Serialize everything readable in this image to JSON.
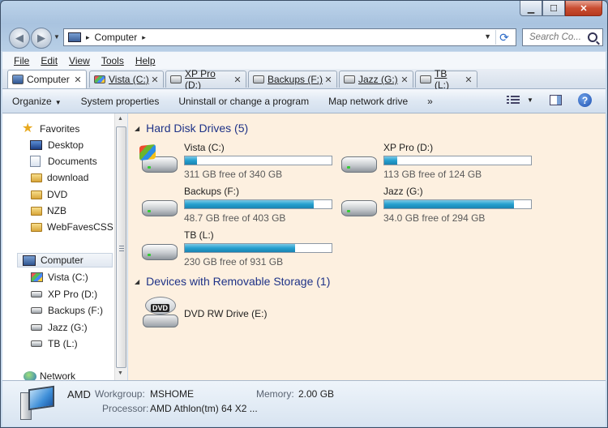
{
  "window": {
    "controls": {
      "minimize": "▁",
      "maximize": "☐",
      "close": "✕"
    }
  },
  "nav": {
    "back": "◀",
    "forward": "▶"
  },
  "address": {
    "location": "Computer",
    "separator": "▸"
  },
  "search": {
    "placeholder": "Search Co..."
  },
  "menu": [
    "File",
    "Edit",
    "View",
    "Tools",
    "Help"
  ],
  "tabs": [
    {
      "label": "Computer",
      "icon": "computer-icon",
      "active": true
    },
    {
      "label": "Vista (C:)",
      "icon": "windows-drive-icon"
    },
    {
      "label": "XP Pro (D:)",
      "icon": "drive-icon"
    },
    {
      "label": "Backups (F:)",
      "icon": "drive-icon"
    },
    {
      "label": "Jazz (G:)",
      "icon": "drive-icon"
    },
    {
      "label": "TB (L:)",
      "icon": "drive-icon"
    }
  ],
  "tab_close": "✕",
  "commands": [
    "Organize",
    "System properties",
    "Uninstall or change a program",
    "Map network drive",
    "»"
  ],
  "help": "?",
  "sidebar": {
    "favorites": "Favorites",
    "favorite_items": [
      "Desktop",
      "Documents",
      "download",
      "DVD",
      "NZB",
      "WebFavesCSS"
    ],
    "computer": "Computer",
    "computer_items": [
      "Vista (C:)",
      "XP Pro (D:)",
      "Backups (F:)",
      "Jazz (G:)",
      "TB (L:)"
    ],
    "network": "Network"
  },
  "groups": {
    "hard_disks": "Hard Disk Drives (5)",
    "removable": "Devices with Removable Storage (1)"
  },
  "drives": [
    {
      "name": "Vista (C:)",
      "free": "311 GB free of 340 GB",
      "used_fraction": 0.085
    },
    {
      "name": "XP Pro (D:)",
      "free": "113 GB free of 124 GB",
      "used_fraction": 0.089
    },
    {
      "name": "Backups (F:)",
      "free": "48.7 GB free of 403 GB",
      "used_fraction": 0.879
    },
    {
      "name": "Jazz (G:)",
      "free": "34.0 GB free of 294 GB",
      "used_fraction": 0.884
    },
    {
      "name": "TB (L:)",
      "free": "230 GB free of 931 GB",
      "used_fraction": 0.753
    }
  ],
  "dvd": {
    "name": "DVD RW Drive (E:)",
    "badge": "DVD"
  },
  "details": {
    "name": "AMD",
    "workgroup_label": "Workgroup:",
    "workgroup": "MSHOME",
    "memory_label": "Memory:",
    "memory": "2.00 GB",
    "processor_label": "Processor:",
    "processor": "AMD Athlon(tm) 64 X2 ..."
  }
}
